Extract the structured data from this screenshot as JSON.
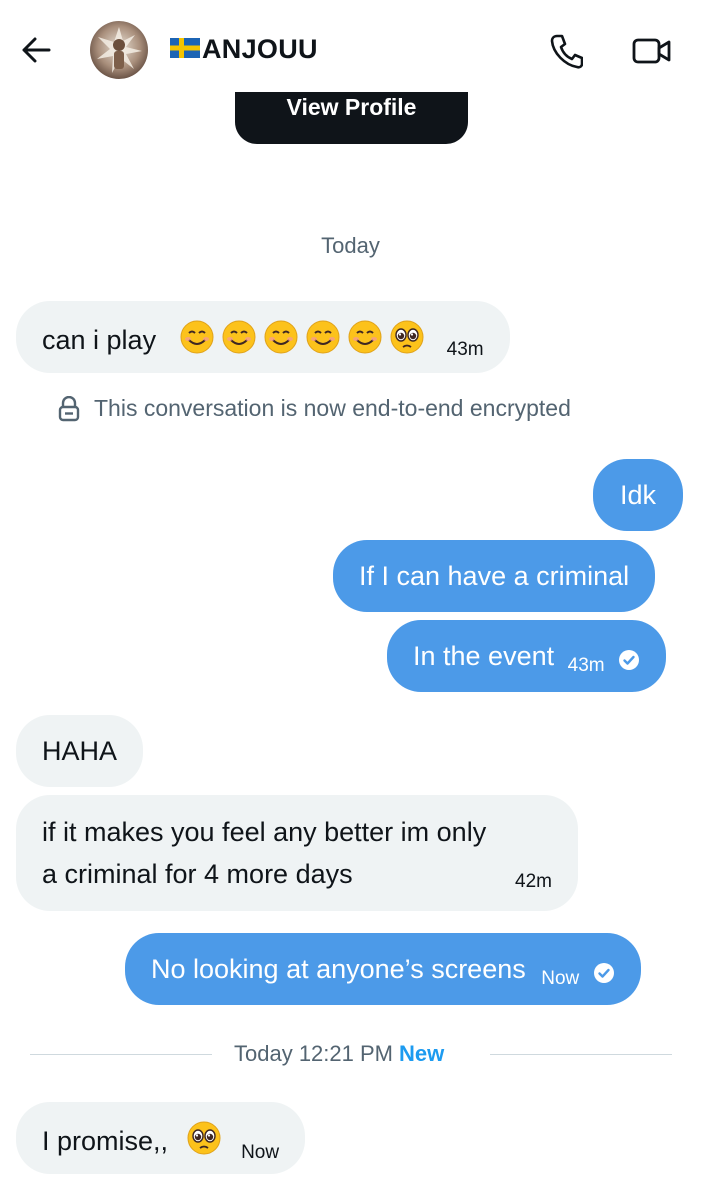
{
  "header": {
    "flag": "🇸🇪",
    "username": "ANJOUU",
    "back_icon": "arrow-left-icon",
    "call_icon": "phone-icon",
    "video_icon": "video-camera-icon"
  },
  "profile": {
    "view_profile_label": "View Profile"
  },
  "day_separator": "Today",
  "encryption_note": "This conversation is now end-to-end encrypted",
  "messages": [
    {
      "direction": "incoming",
      "text": "can i play",
      "emoji": [
        "smiling-face-icon",
        "smiling-face-icon",
        "smiling-face-icon",
        "smiling-face-icon",
        "smiling-face-icon",
        "pleading-face-icon"
      ],
      "time": "43m"
    },
    {
      "direction": "outgoing",
      "text": "Idk"
    },
    {
      "direction": "outgoing",
      "text": "If I can have a criminal"
    },
    {
      "direction": "outgoing",
      "text": "In the event",
      "time": "43m",
      "status": "seen"
    },
    {
      "direction": "incoming",
      "text": "HAHA"
    },
    {
      "direction": "incoming",
      "text_line1": "if it makes you feel any better im only",
      "text_line2": "a criminal for 4 more days",
      "time": "42m"
    },
    {
      "direction": "outgoing",
      "text": "No looking at anyone’s screens",
      "time": "Now",
      "status": "seen"
    },
    {
      "direction": "incoming",
      "text": "I promise,,",
      "emoji": [
        "pleading-face-icon"
      ],
      "time": "Now"
    }
  ],
  "new_separator": {
    "time": "Today 12:21 PM",
    "label": "New"
  },
  "colors": {
    "outgoing_bubble": "#4c9ae8",
    "incoming_bubble": "#eff3f4",
    "new_label": "#1d9bf0",
    "muted_text": "#536471"
  }
}
